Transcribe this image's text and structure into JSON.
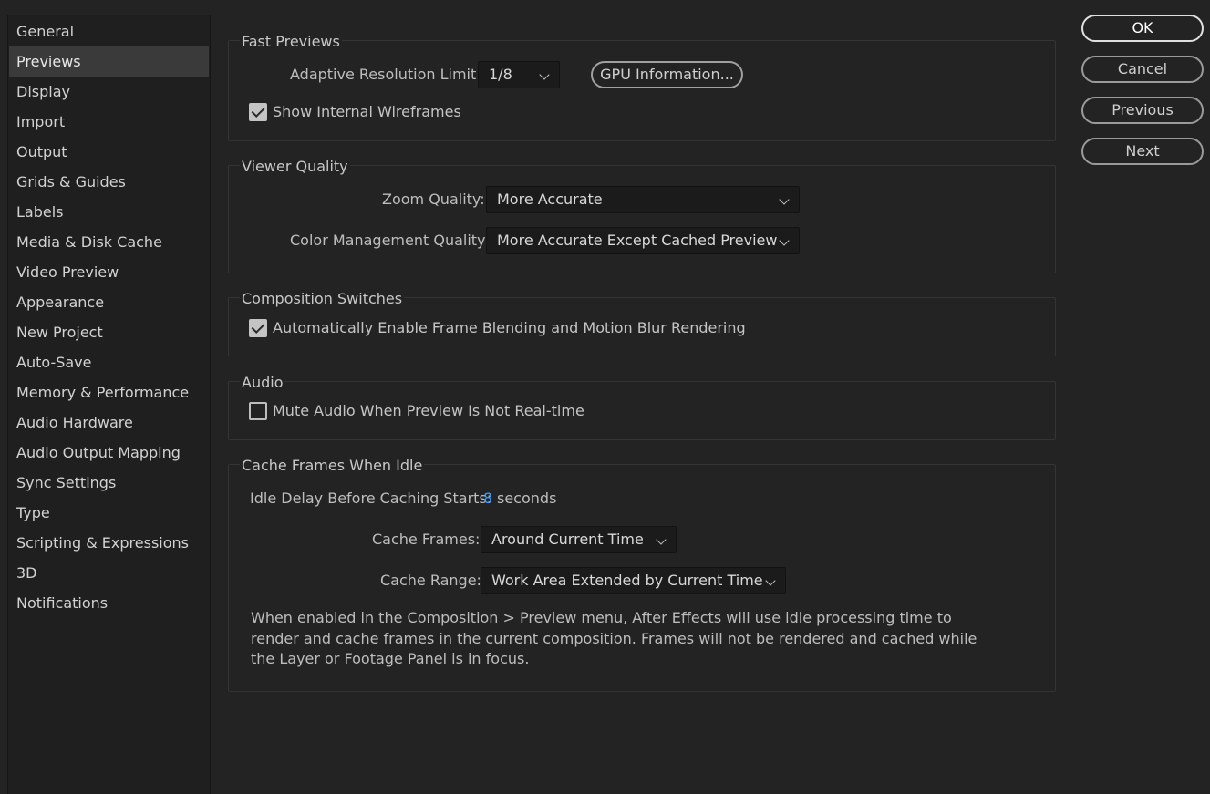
{
  "sidebar": {
    "items": [
      {
        "label": "General"
      },
      {
        "label": "Previews",
        "selected": true
      },
      {
        "label": "Display"
      },
      {
        "label": "Import"
      },
      {
        "label": "Output"
      },
      {
        "label": "Grids & Guides"
      },
      {
        "label": "Labels"
      },
      {
        "label": "Media & Disk Cache"
      },
      {
        "label": "Video Preview"
      },
      {
        "label": "Appearance"
      },
      {
        "label": "New Project"
      },
      {
        "label": "Auto-Save"
      },
      {
        "label": "Memory & Performance"
      },
      {
        "label": "Audio Hardware"
      },
      {
        "label": "Audio Output Mapping"
      },
      {
        "label": "Sync Settings"
      },
      {
        "label": "Type"
      },
      {
        "label": "Scripting & Expressions"
      },
      {
        "label": "3D"
      },
      {
        "label": "Notifications"
      }
    ]
  },
  "buttons": {
    "ok": "OK",
    "cancel": "Cancel",
    "previous": "Previous",
    "next": "Next"
  },
  "fast_previews": {
    "title": "Fast Previews",
    "adaptive_label": "Adaptive Resolution Limit:",
    "adaptive_value": "1/8",
    "gpu_button": "GPU Information...",
    "wireframes_label": "Show Internal Wireframes",
    "wireframes_checked": true
  },
  "viewer_quality": {
    "title": "Viewer Quality",
    "zoom_label": "Zoom Quality:",
    "zoom_value": "More Accurate",
    "color_label": "Color Management Quality:",
    "color_value": "More Accurate Except Cached Preview"
  },
  "composition_switches": {
    "title": "Composition Switches",
    "blending_label": "Automatically Enable Frame Blending and Motion Blur Rendering",
    "blending_checked": true
  },
  "audio": {
    "title": "Audio",
    "mute_label": "Mute Audio When Preview Is Not Real-time",
    "mute_checked": false
  },
  "cache_idle": {
    "title": "Cache Frames When Idle",
    "delay_label": "Idle Delay Before Caching Starts:",
    "delay_value": "8",
    "delay_unit": "seconds",
    "frames_label": "Cache Frames:",
    "frames_value": "Around Current Time",
    "range_label": "Cache Range:",
    "range_value": "Work Area Extended by Current Time",
    "description": "When enabled in the Composition > Preview menu, After Effects will use idle processing time to render and cache frames in the current composition. Frames will not be rendered and cached while the Layer or Footage Panel is in focus."
  },
  "colors": {
    "background": "#232323",
    "sidebar_bg": "#1f1f1f",
    "selected_bg": "#3a3a3a",
    "accent_value": "#3ea0ff"
  }
}
